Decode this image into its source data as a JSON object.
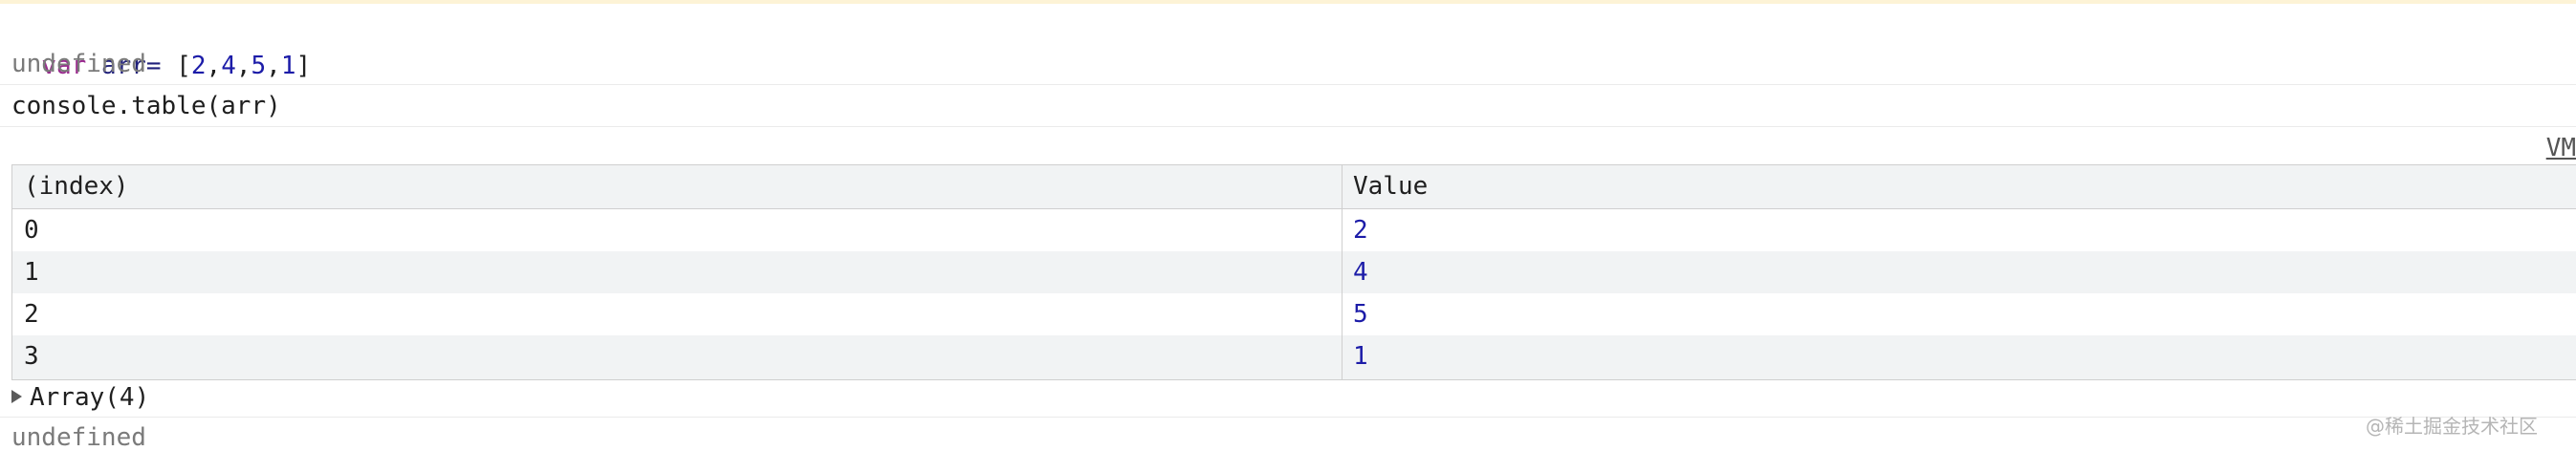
{
  "console": {
    "input1": {
      "keyword": "var",
      "identifier": "arr=",
      "value_open": " [",
      "values": [
        "2",
        "4",
        "5",
        "1"
      ],
      "value_close": "]"
    },
    "result1": "undefined",
    "input2": "console.table(arr)",
    "source_link": "VM",
    "table": {
      "headers": [
        "(index)",
        "Value"
      ],
      "rows": [
        {
          "index": "0",
          "value": "2"
        },
        {
          "index": "1",
          "value": "4"
        },
        {
          "index": "2",
          "value": "5"
        },
        {
          "index": "3",
          "value": "1"
        }
      ]
    },
    "array_summary": "Array(4)",
    "result2": "undefined"
  },
  "watermark": "@稀土掘金技术社区",
  "colors": {
    "keyword": "#9a2a8f",
    "number": "#1c1ca8",
    "muted": "#7a7a7a",
    "table_header_bg": "#f1f3f4",
    "border": "#cfcfcf"
  },
  "icons": {
    "expand": "triangle-right-icon"
  }
}
